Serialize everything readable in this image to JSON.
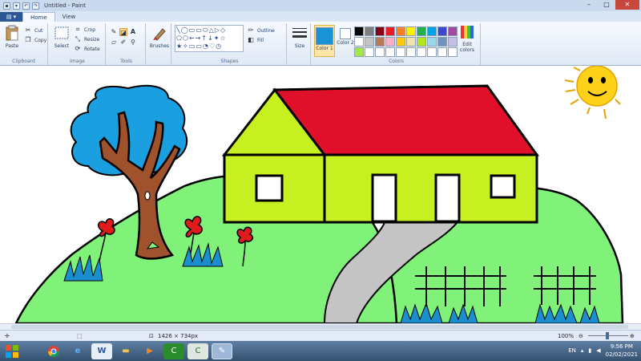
{
  "window": {
    "title": "Untitled - Paint",
    "controls": {
      "minimize": "–",
      "maximize": "□",
      "close": "✕"
    }
  },
  "tabs": [
    {
      "label": "Home",
      "active": true
    },
    {
      "label": "View",
      "active": false
    }
  ],
  "ribbon": {
    "clipboard": {
      "label": "Clipboard",
      "paste": "Paste",
      "cut": "Cut",
      "copy": "Copy"
    },
    "image": {
      "label": "Image",
      "select": "Select",
      "crop": "Crop",
      "resize": "Resize",
      "rotate": "Rotate"
    },
    "tools": {
      "label": "Tools"
    },
    "brushes": {
      "label": "Brushes"
    },
    "shapes": {
      "label": "Shapes",
      "outline": "Outline",
      "fill": "Fill",
      "glyphs": "╲◯▭▭⬭△▷◇ ⬠⬡←→↑↓✦☆ ★✧▭▭◔♡◷"
    },
    "size": {
      "label": "Size"
    },
    "colors": {
      "label": "Colors",
      "color1": "Color 1",
      "color2": "Color 2",
      "edit": "Edit colors",
      "color1_value": "#1a93d6",
      "color2_value": "#ffffff",
      "palette": [
        "#000000",
        "#7f7f7f",
        "#880015",
        "#ed1c24",
        "#ff7f27",
        "#fff200",
        "#22b14c",
        "#00a2e8",
        "#3f48cc",
        "#a349a4",
        "#ffffff",
        "#c3c3c3",
        "#b97a57",
        "#ffaec9",
        "#ffc90e",
        "#efe4b0",
        "#b5e61d",
        "#99d9ea",
        "#7092be",
        "#c8bfe7",
        "#a6e84b",
        "#ffffff",
        "#ffffff",
        "#ffffff",
        "#ffffff",
        "#ffffff",
        "#ffffff",
        "#ffffff",
        "#ffffff",
        "#ffffff"
      ]
    }
  },
  "status": {
    "dimensions": "1426 × 734px",
    "zoom": "100%"
  },
  "taskbar": {
    "lang": "EN",
    "time": "9:56 PM",
    "date": "02/02/2021"
  }
}
